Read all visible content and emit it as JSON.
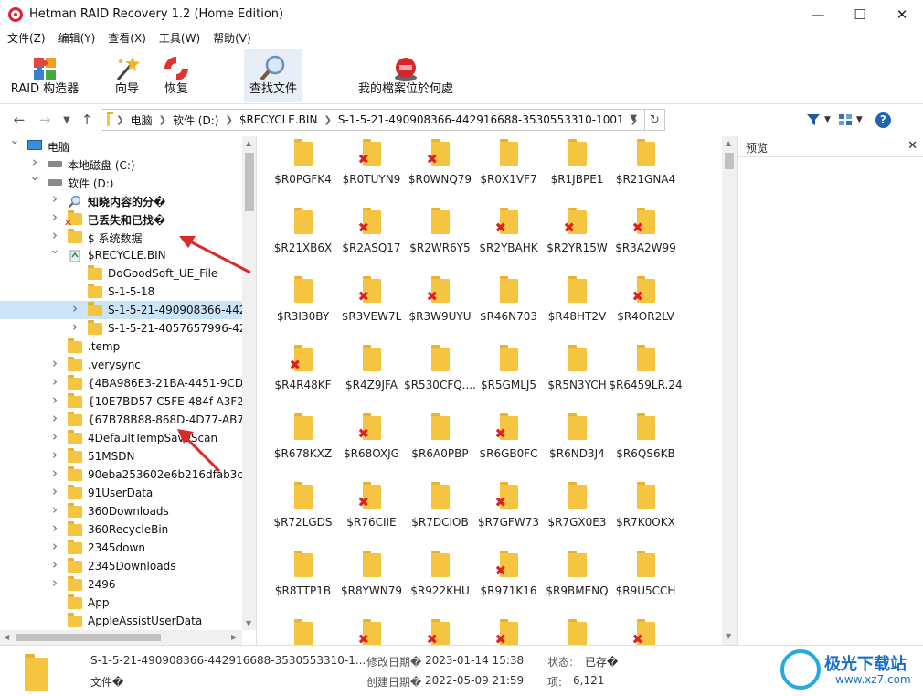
{
  "window": {
    "title": "Hetman RAID Recovery 1.2 (Home Edition)"
  },
  "menu": [
    "文件(Z)",
    "编辑(Y)",
    "查看(X)",
    "工具(W)",
    "帮助(V)"
  ],
  "toolbar": {
    "raid_builder": "RAID 构造器",
    "wizard": "向导",
    "recover": "恢复",
    "find_file": "查找文件",
    "where_files": "我的檔案位於何處"
  },
  "address": {
    "crumbs": [
      "电脑",
      "软件 (D:)",
      "$RECYCLE.BIN",
      "S-1-5-21-490908366-442916688-3530553310-1001"
    ]
  },
  "tree": [
    {
      "label": "电脑",
      "level": 0,
      "icon": "pc-icon",
      "chevron": "down"
    },
    {
      "label": "本地磁盘 (C:)",
      "level": 1,
      "icon": "drive-icon",
      "chevron": "right"
    },
    {
      "label": "软件 (D:)",
      "level": 1,
      "icon": "drive-icon",
      "chevron": "down"
    },
    {
      "label": "知晓内容的分�",
      "level": 2,
      "icon": "search-icon",
      "chevron": "right",
      "bold": true
    },
    {
      "label": "已丢失和已找�",
      "level": 2,
      "icon": "lost-folder-icon",
      "chevron": "right",
      "bold": true
    },
    {
      "label": "$ 系统数据",
      "level": 2,
      "icon": "folder-icon",
      "chevron": "right"
    },
    {
      "label": "$RECYCLE.BIN",
      "level": 2,
      "icon": "recycle-icon",
      "chevron": "down"
    },
    {
      "label": "DoGoodSoft_UE_File",
      "level": 3,
      "icon": "folder-icon",
      "chevron": ""
    },
    {
      "label": "S-1-5-18",
      "level": 3,
      "icon": "folder-icon",
      "chevron": ""
    },
    {
      "label": "S-1-5-21-490908366-44291€",
      "level": 3,
      "icon": "folder-icon",
      "chevron": "right",
      "selected": true
    },
    {
      "label": "S-1-5-21-4057657996-42545",
      "level": 3,
      "icon": "folder-icon",
      "chevron": "right"
    },
    {
      "label": ".temp",
      "level": 2,
      "icon": "folder-icon",
      "chevron": ""
    },
    {
      "label": ".verysync",
      "level": 2,
      "icon": "folder-icon",
      "chevron": "right"
    },
    {
      "label": "{4BA986E3-21BA-4451-9CD0-BD",
      "level": 2,
      "icon": "folder-icon",
      "chevron": "right"
    },
    {
      "label": "{10E7BD57-C5FE-484f-A3F2-A17",
      "level": 2,
      "icon": "folder-icon",
      "chevron": "right"
    },
    {
      "label": "{67B78B88-868D-4D77-AB70-D0",
      "level": 2,
      "icon": "folder-icon",
      "chevron": "right"
    },
    {
      "label": "4DefaultTempSaveScan",
      "level": 2,
      "icon": "folder-icon",
      "chevron": "right"
    },
    {
      "label": "51MSDN",
      "level": 2,
      "icon": "folder-icon",
      "chevron": "right"
    },
    {
      "label": "90eba253602e6b216dfab3cd4d8",
      "level": 2,
      "icon": "folder-icon",
      "chevron": "right"
    },
    {
      "label": "91UserData",
      "level": 2,
      "icon": "folder-icon",
      "chevron": "right"
    },
    {
      "label": "360Downloads",
      "level": 2,
      "icon": "folder-icon",
      "chevron": "right"
    },
    {
      "label": "360RecycleBin",
      "level": 2,
      "icon": "folder-icon",
      "chevron": "right"
    },
    {
      "label": "2345down",
      "level": 2,
      "icon": "folder-icon",
      "chevron": "right"
    },
    {
      "label": "2345Downloads",
      "level": 2,
      "icon": "folder-icon",
      "chevron": "right"
    },
    {
      "label": "2496",
      "level": 2,
      "icon": "folder-icon",
      "chevron": "right"
    },
    {
      "label": "App",
      "level": 2,
      "icon": "folder-icon",
      "chevron": ""
    },
    {
      "label": "AppleAssistUserData",
      "level": 2,
      "icon": "folder-icon",
      "chevron": ""
    }
  ],
  "files": [
    {
      "name": "$R0PGFK4",
      "deleted": false
    },
    {
      "name": "$R0TUYN9",
      "deleted": true
    },
    {
      "name": "$R0WNQ79",
      "deleted": true
    },
    {
      "name": "$R0X1VF7",
      "deleted": false
    },
    {
      "name": "$R1JBPE1",
      "deleted": false
    },
    {
      "name": "$R21GNA4",
      "deleted": false
    },
    {
      "name": "$R21XB6X",
      "deleted": false
    },
    {
      "name": "$R2ASQ17",
      "deleted": true
    },
    {
      "name": "$R2WR6Y5",
      "deleted": false
    },
    {
      "name": "$R2YBAHK",
      "deleted": true
    },
    {
      "name": "$R2YR15W",
      "deleted": true
    },
    {
      "name": "$R3A2W99",
      "deleted": true
    },
    {
      "name": "$R3I30BY",
      "deleted": false
    },
    {
      "name": "$R3VEW7L",
      "deleted": true
    },
    {
      "name": "$R3W9UYU",
      "deleted": true
    },
    {
      "name": "$R46N703",
      "deleted": false
    },
    {
      "name": "$R48HT2V",
      "deleted": false
    },
    {
      "name": "$R4OR2LV",
      "deleted": true
    },
    {
      "name": "$R4R48KF",
      "deleted": true
    },
    {
      "name": "$R4Z9JFA",
      "deleted": false
    },
    {
      "name": "$R530CFQ....",
      "deleted": false
    },
    {
      "name": "$R5GMLJ5",
      "deleted": false
    },
    {
      "name": "$R5N3YCH",
      "deleted": false
    },
    {
      "name": "$R6459LR.24",
      "deleted": false
    },
    {
      "name": "$R678KXZ",
      "deleted": false
    },
    {
      "name": "$R68OXJG",
      "deleted": true
    },
    {
      "name": "$R6A0PBP",
      "deleted": false
    },
    {
      "name": "$R6GB0FC",
      "deleted": true
    },
    {
      "name": "$R6ND3J4",
      "deleted": false
    },
    {
      "name": "$R6QS6KB",
      "deleted": false
    },
    {
      "name": "$R72LGDS",
      "deleted": false
    },
    {
      "name": "$R76CIIE",
      "deleted": true
    },
    {
      "name": "$R7DCIOB",
      "deleted": false
    },
    {
      "name": "$R7GFW73",
      "deleted": true
    },
    {
      "name": "$R7GX0E3",
      "deleted": false
    },
    {
      "name": "$R7K0OKX",
      "deleted": false
    },
    {
      "name": "$R8TTP1B",
      "deleted": false
    },
    {
      "name": "$R8YWN79",
      "deleted": false
    },
    {
      "name": "$R922KHU",
      "deleted": false
    },
    {
      "name": "$R971K16",
      "deleted": true
    },
    {
      "name": "$R9BMENQ",
      "deleted": false
    },
    {
      "name": "$R9U5CCH",
      "deleted": false
    },
    {
      "name": "",
      "deleted": false
    },
    {
      "name": "",
      "deleted": true
    },
    {
      "name": "",
      "deleted": true
    },
    {
      "name": "",
      "deleted": true
    },
    {
      "name": "",
      "deleted": false
    },
    {
      "name": "",
      "deleted": true
    }
  ],
  "preview": {
    "title": "预览"
  },
  "status": {
    "name": "S-1-5-21-490908366-442916688-3530553310-1...",
    "type": "文件�",
    "modified_label": "修改日期�",
    "modified_value": "2023-01-14 15:38",
    "created_label": "创建日期�",
    "created_value": "2022-05-09 21:59",
    "state_label": "状态:",
    "state_value": "已存�",
    "items_label": "项:",
    "items_value": "6,121"
  },
  "watermark": {
    "text": "极光下载站",
    "url": "www.xz7.com"
  },
  "colors": {
    "folder": "#f5c542",
    "selected": "#cce4f7",
    "deleted_mark": "#e02020",
    "annotation_arrow": "#d92b2b"
  }
}
